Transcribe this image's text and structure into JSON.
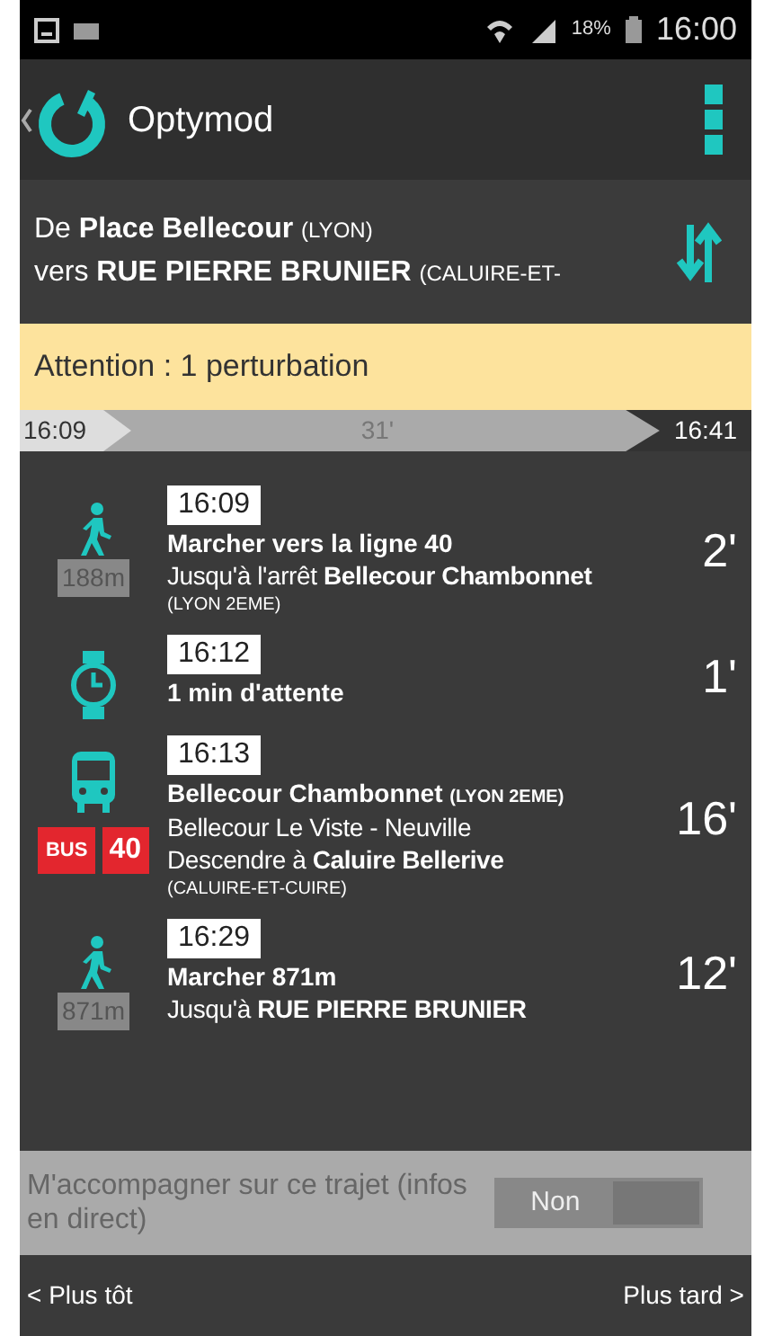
{
  "status_bar": {
    "battery": "18%",
    "time": "16:00"
  },
  "app_bar": {
    "title": "Optymod"
  },
  "route": {
    "from": {
      "prefix": "De",
      "name": "Place Bellecour",
      "city": "(LYON)"
    },
    "to": {
      "prefix": "vers",
      "name": "RUE PIERRE BRUNIER",
      "city": "(CALUIRE-ET-"
    }
  },
  "alert": "Attention : 1 perturbation",
  "timeline": {
    "start": "16:09",
    "duration": "31'",
    "end": "16:41"
  },
  "steps": [
    {
      "kind": "walk",
      "time": "16:09",
      "title": "Marcher vers la ligne 40",
      "lines": [
        "Jusqu'à l'arrêt **Bellecour Chambonnet**"
      ],
      "note": "(LYON 2EME)",
      "distance": "188m",
      "duration": "2'"
    },
    {
      "kind": "wait",
      "time": "16:12",
      "title": "1 min d'attente",
      "duration": "1'"
    },
    {
      "kind": "bus",
      "time": "16:13",
      "title": "Bellecour Chambonnet",
      "title_note": "(LYON 2EME)",
      "lines": [
        "Bellecour Le Viste - Neuville",
        "Descendre à **Caluire Bellerive**"
      ],
      "note": "(CALUIRE-ET-CUIRE)",
      "badge": {
        "mode": "BUS",
        "line": "40"
      },
      "duration": "16'"
    },
    {
      "kind": "walk",
      "time": "16:29",
      "title": "Marcher 871m",
      "lines": [
        "Jusqu'à **RUE PIERRE BRUNIER**"
      ],
      "distance": "871m",
      "duration": "12'"
    }
  ],
  "follow": {
    "label": "M'accompagner sur ce trajet (infos en direct)",
    "state": "Non",
    "on": false
  },
  "nav": {
    "earlier": "< Plus tôt",
    "later": "Plus tard >"
  }
}
